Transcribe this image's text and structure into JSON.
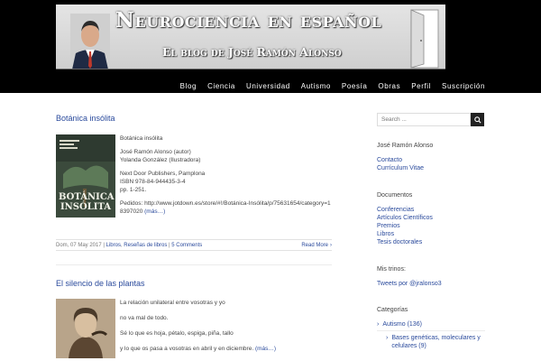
{
  "header": {
    "title": "Neurociencia en español",
    "subtitle": "El blog de José Ramón Alonso"
  },
  "nav": {
    "items": [
      "Blog",
      "Ciencia",
      "Universidad",
      "Autismo",
      "Poesía",
      "Obras",
      "Perfil",
      "Suscripción"
    ]
  },
  "posts": [
    {
      "title": "Botánica insólita",
      "cover_text": "BOTÁNICA INSÓLITA",
      "lines": [
        "Botánica insólita",
        "José Ramón Alonso (autor)",
        "Yolanda González (Ilustradora)",
        "Next Door Publishers, Pamplona",
        "ISBN 978-84-944435-3-4",
        "pp. 1-251.",
        "Pedidos: http://www.jotdown.es/store/#!/Botánica-Insólita/p/75631654/category=18397020"
      ],
      "more": "(más…)",
      "meta": {
        "date": "Dom, 07 May 2017",
        "sep": "|",
        "categories": [
          "Libros",
          "Reseñas de libros"
        ],
        "comments": "5 Comments",
        "read_more": "Read More"
      }
    },
    {
      "title": "El silencio de las plantas",
      "lines": [
        "La relación unilateral entre vosotras y yo",
        "no va mal de todo.",
        "Sé lo que es hoja, pétalo, espiga, piña, tallo",
        "y lo que os pasa a vosotras en abril y en diciembre."
      ],
      "more": "(más…)"
    }
  ],
  "sidebar": {
    "search_placeholder": "Search ...",
    "author_heading": "José Ramón Alonso",
    "author_links": [
      "Contacto",
      "Currículum Vitae"
    ],
    "docs_heading": "Documentos",
    "docs_links": [
      "Conferencias",
      "Artículos Científicos",
      "Premios",
      "Libros",
      "Tesis doctorales"
    ],
    "tweets_heading": "Mis trinos:",
    "tweets_link": "Tweets por @jralonso3",
    "categories_heading": "Categorías",
    "categories": [
      {
        "label": "Autismo (136)",
        "sub": false
      },
      {
        "label": "Bases genéticas, moleculares y celulares (9)",
        "sub": true
      }
    ]
  },
  "colors": {
    "link": "#2a4a9c",
    "header_bg": "#000000"
  }
}
